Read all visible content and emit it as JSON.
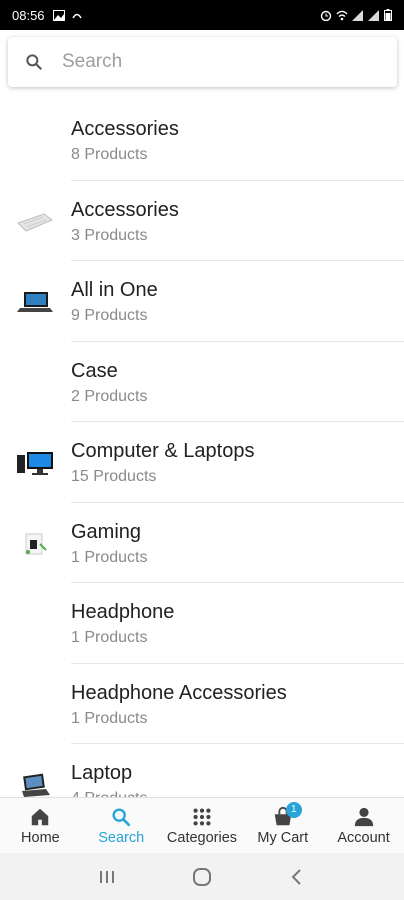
{
  "status_bar": {
    "time": "08:56",
    "icons_left": [
      "image-icon",
      "link-icon"
    ],
    "icons_right": [
      "alarm-icon",
      "wifi-icon",
      "signal-icon",
      "signal-icon",
      "battery-icon"
    ]
  },
  "search": {
    "placeholder": "Search",
    "value": ""
  },
  "categories": [
    {
      "name": "Accessories",
      "count": "8 Products",
      "thumb": "none"
    },
    {
      "name": "Accessories",
      "count": "3 Products",
      "thumb": "keyboard-thumb"
    },
    {
      "name": "All in One",
      "count": "9 Products",
      "thumb": "laptop-thumb"
    },
    {
      "name": "Case",
      "count": "2 Products",
      "thumb": "none"
    },
    {
      "name": "Computer & Laptops",
      "count": "15 Products",
      "thumb": "desktop-thumb"
    },
    {
      "name": "Gaming",
      "count": "1 Products",
      "thumb": "gaming-thumb"
    },
    {
      "name": "Headphone",
      "count": "1 Products",
      "thumb": "none"
    },
    {
      "name": "Headphone Accessories",
      "count": "1 Products",
      "thumb": "none"
    },
    {
      "name": "Laptop",
      "count": "4 Products",
      "thumb": "laptop2-thumb"
    }
  ],
  "bottom_nav": {
    "items": [
      {
        "label": "Home",
        "icon": "home-icon"
      },
      {
        "label": "Search",
        "icon": "search-icon",
        "active": true
      },
      {
        "label": "Categories",
        "icon": "grid-icon"
      },
      {
        "label": "My Cart",
        "icon": "cart-icon",
        "badge": "1"
      },
      {
        "label": "Account",
        "icon": "person-icon"
      }
    ]
  },
  "colors": {
    "accent": "#29a4d9",
    "text": "#212121",
    "secondary_text": "#8a8a8a"
  }
}
